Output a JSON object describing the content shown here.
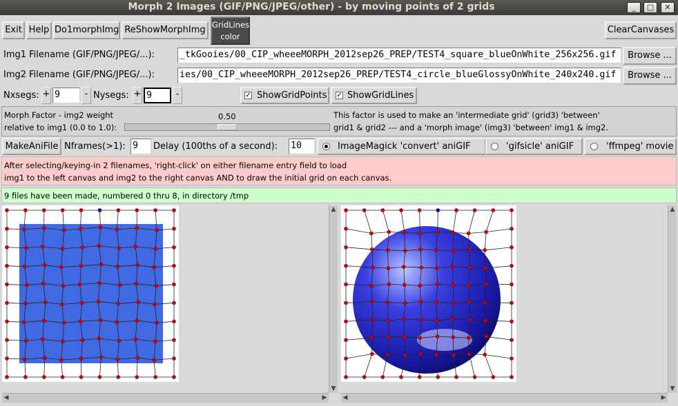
{
  "window": {
    "title": "Morph 2 Images (GIF/PNG/JPEG/other) - by moving points of 2 grids",
    "minimize": "_",
    "maximize": "□",
    "close": "✕"
  },
  "toolbar": {
    "exit": "Exit",
    "help": "Help",
    "do1morph": "Do1morphImg",
    "reshow": "ReShowMorphImg",
    "gridlines_line1": "GridLines",
    "gridlines_line2": "color",
    "clear": "ClearCanvases"
  },
  "files": {
    "img1_label": "Img1 Filename (GIF/PNG/JPEG/...):",
    "img1_value": "_tkGooies/00_CIP_wheeeMORPH_2012sep26_PREP/TEST4_square_blueOnWhite_256x256.gif",
    "img2_label": "Img2 Filename (GIF/PNG/JPEG/...):",
    "img2_value": "ies/00_CIP_wheeeMORPH_2012sep26_PREP/TEST4_circle_blueGlossyOnWhite_240x240.gif",
    "browse": "Browse ..."
  },
  "segs": {
    "nx_label": "Nxsegs:",
    "nx_value": "9",
    "ny_label": "Nysegs:",
    "ny_value": "9",
    "plus": "+",
    "minus": "-",
    "show_points": "ShowGridPoints",
    "show_lines": "ShowGridLines",
    "show_points_checked": true,
    "show_lines_checked": true
  },
  "morph": {
    "label_line1": "Morph Factor - img2 weight",
    "label_line2": "relative to img1 (0.0 to 1.0):",
    "value": "0.50",
    "value_fraction": 0.5,
    "desc_line1": "This factor is used to make an 'intermediate grid' (grid3) 'between'",
    "desc_line2": "grid1 & grid2 --- and a 'morph image' (img3) 'between' img1 & img2."
  },
  "anim": {
    "make_btn": "MakeAniFile",
    "nframes_label": "Nframes(>1):",
    "nframes_value": "9",
    "delay_label": "Delay (100ths of a second):",
    "delay_value": "10",
    "opt_imagemagick": "ImageMagick 'convert' aniGIF",
    "opt_gifsicle": "'gifsicle' aniGIF",
    "opt_ffmpeg": "'ffmpeg' movie",
    "selected": "imagemagick"
  },
  "info": {
    "line1": "After selecting/keying-in 2 filenames, 'right-click' on either filename entry field to load",
    "line2": "img1 to the left canvas and img2 to the right canvas AND to draw the initial grid on each canvas."
  },
  "status": {
    "text": "9 files have been made, numbered 0 thru 8,  in directory /tmp"
  },
  "colors": {
    "info_bg": "#ffcccc",
    "status_bg": "#ccffcc",
    "square_blue": "#4169e1",
    "grid_point": "#d40000",
    "grid_point_selected": "#0000cc",
    "gridlines_btn_bg": "#4a4a4a"
  }
}
